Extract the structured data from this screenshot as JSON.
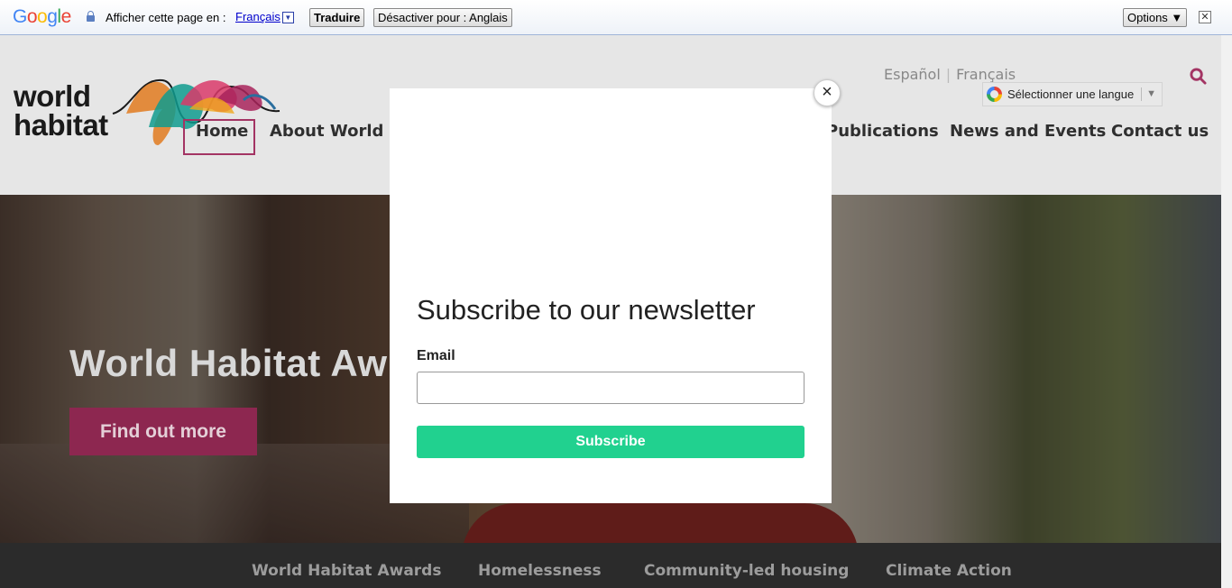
{
  "translate_bar": {
    "logo": "Google",
    "prompt": "Afficher cette page en :",
    "language": "Français",
    "translate_button": "Traduire",
    "disable_button": "Désactiver pour : Anglais",
    "options_button": "Options ▼",
    "close": "✕"
  },
  "site": {
    "logo_line1": "world",
    "logo_line2": "habitat",
    "lang_links": [
      "Español",
      "Français"
    ],
    "lang_select_label": "Sélectionner une langue",
    "nav": [
      "Home",
      "About World Ha",
      "Publications",
      "News and Events",
      "Contact us"
    ]
  },
  "hero": {
    "title": "World Habitat Aw",
    "cta": "Find out more"
  },
  "subnav": [
    "World Habitat Awards",
    "Homelessness",
    "Community-led housing",
    "Climate Action"
  ],
  "modal": {
    "close": "×",
    "title": "Subscribe to our newsletter",
    "email_label": "Email",
    "email_value": "",
    "subscribe_button": "Subscribe"
  },
  "colors": {
    "brand_magenta": "#8d2750",
    "subscribe_green": "#21d18f"
  }
}
